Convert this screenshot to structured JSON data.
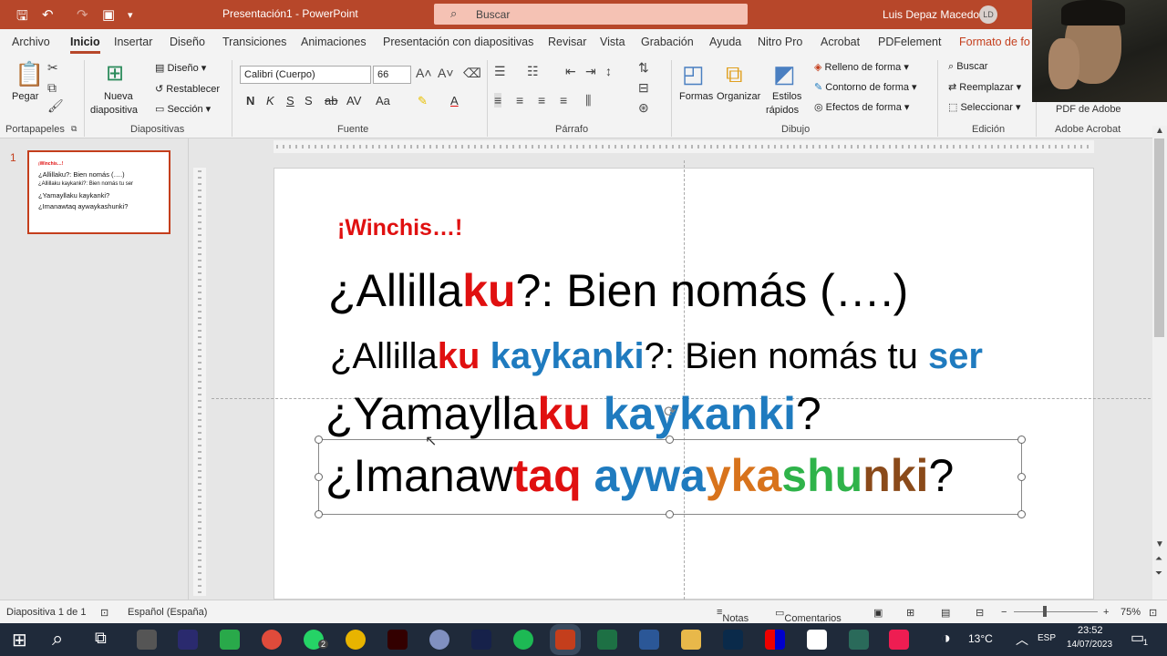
{
  "window": {
    "title": "Presentación1 - PowerPoint",
    "search": "Buscar",
    "user": "Luis Depaz Macedo",
    "initials": "LD"
  },
  "tabs": [
    "Archivo",
    "Inicio",
    "Insertar",
    "Diseño",
    "Transiciones",
    "Animaciones",
    "Presentación con diapositivas",
    "Revisar",
    "Vista",
    "Grabación",
    "Ayuda",
    "Nitro Pro",
    "Acrobat",
    "PDFelement",
    "Formato de fo"
  ],
  "ribbon": {
    "paste": "Pegar",
    "new_slide_1": "Nueva",
    "new_slide_2": "diapositiva",
    "layout": "Diseño",
    "reset": "Restablecer",
    "section": "Sección",
    "font": "Calibri (Cuerpo)",
    "size": "66",
    "shapes": "Formas",
    "arrange": "Organizar",
    "styles_1": "Estilos",
    "styles_2": "rápidos",
    "fill": "Relleno de forma",
    "outline": "Contorno de forma",
    "effects": "Efectos de forma",
    "find": "Buscar",
    "replace": "Reemplazar",
    "select": "Seleccionar",
    "pdf": "PDF de Adobe",
    "groups": {
      "clipboard": "Portapapeles",
      "slides": "Diapositivas",
      "font": "Fuente",
      "paragraph": "Párrafo",
      "drawing": "Dibujo",
      "editing": "Edición",
      "acrobat": "Adobe Acrobat"
    }
  },
  "thumbnail": {
    "number": "1",
    "l0": "¡Winchis…!",
    "l1": "¿Allillaku?: Bien nomás (….)",
    "l2": "¿Allillaku kaykanki?: Bien nomás tu ser",
    "l3": "¿Yamayllaku kaykanki?",
    "l4": "¿Imanawtaq aywaykashunki?"
  },
  "slide": {
    "title": "¡Winchis…!",
    "l1a": "¿Allilla",
    "l1b": "ku",
    "l1c": "?: Bien nomás (….)",
    "l2a": "¿Allilla",
    "l2b": "ku",
    "l2c": "kaykanki",
    "l2d": "?: Bien nomás tu ",
    "l2e": "ser",
    "l3a": "¿Yamaylla",
    "l3b": "ku",
    "l3c": "kaykanki",
    "l3d": "?",
    "l4a": "¿Imanaw",
    "l4b": "taq",
    "l4c": "aywa",
    "l4d": "y",
    "l4e": "ka",
    "l4f": "shu",
    "l4g": "nki",
    "l4h": "?"
  },
  "status": {
    "slide": "Diapositiva 1 de 1",
    "lang": "Español (España)",
    "notes": "Notas",
    "comments": "Comentarios",
    "zoom": "75%"
  },
  "taskbar": {
    "temp": "13°C",
    "lang": "ESP",
    "time": "23:52",
    "date": "14/07/2023",
    "badge": "2",
    "notif": "1"
  }
}
